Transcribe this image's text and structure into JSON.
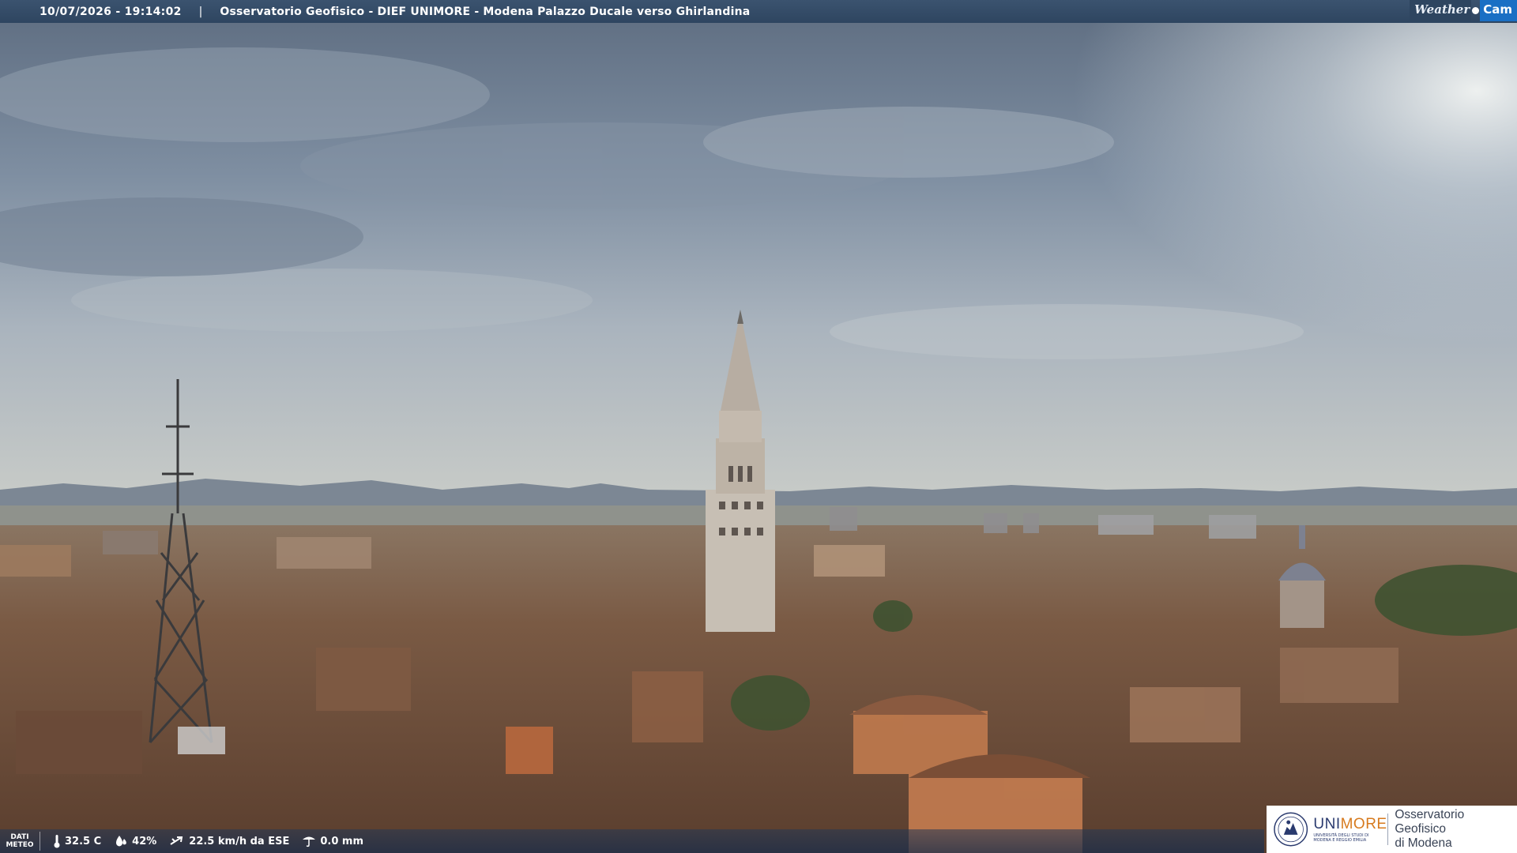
{
  "caption": {
    "timestamp": "10/07/2026 - 19:14:02",
    "separator": "|",
    "title": "Osservatorio Geofisico - DIEF UNIMORE - Modena Palazzo Ducale verso Ghirlandina"
  },
  "brand": {
    "weather_text": "Weather",
    "cam_text": "Cam"
  },
  "meteo": {
    "label_line1": "DATI",
    "label_line2": "METEO",
    "temperature": "32.5 C",
    "humidity": "42%",
    "wind": "22.5 km/h da ESE",
    "rain": "0.0 mm",
    "icons": [
      "thermometer-icon",
      "humidity-drop-icon",
      "wind-icon",
      "rain-gauge-icon"
    ]
  },
  "logo": {
    "university_prefix": "UNI",
    "university_suffix": "MORE",
    "university_subtitle": "UNIVERSITÀ DEGLI STUDI DI MODENA E REGGIO EMILIA",
    "observatory_line1": "Osservatorio Geofisico",
    "observatory_line2": "di Modena"
  },
  "colors": {
    "caption_bar": "#2e4560",
    "cam_badge": "#1a6fc4",
    "unimore_blue": "#2a3a6e",
    "unimore_orange": "#d77a1e"
  }
}
